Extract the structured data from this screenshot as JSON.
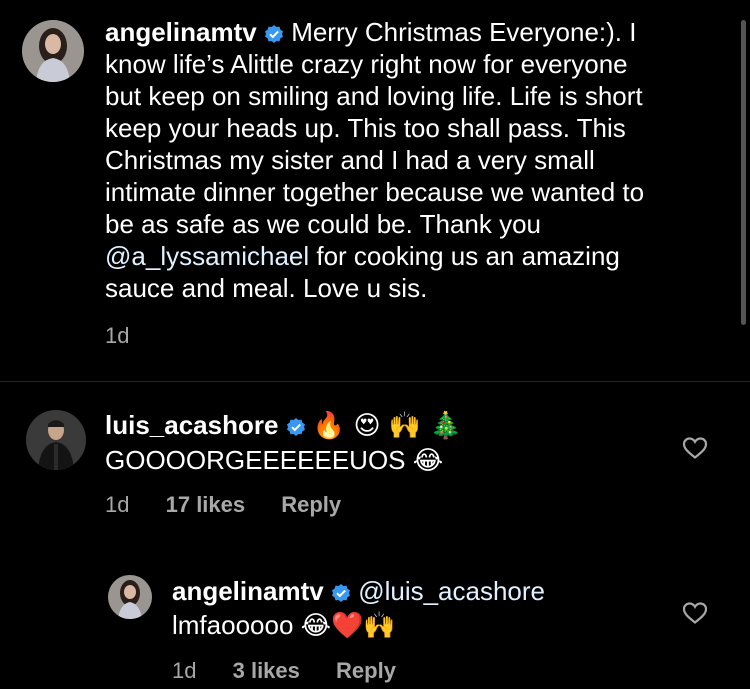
{
  "caption": {
    "username": "angelinamtv",
    "lines": [
      "Merry Christmas Everyone:). I",
      "know life’s Alittle crazy right now for everyone",
      "but keep on smiling and loving life. Life is short",
      "keep your heads up. This too shall pass. This",
      "Christmas my sister and I had a very small",
      "intimate dinner together because we wanted to",
      "be as safe as we could be. Thank you"
    ],
    "mention": "@a_lyssamichael",
    "line8_rest": " for cooking us an amazing",
    "line9": "sauce and meal. Love u sis.",
    "time": "1d"
  },
  "comment": {
    "username": "luis_acashore",
    "emojis_line1": "🔥 😍 🙌 🎄",
    "text": "GOOOORGEEEEEEUOS",
    "text_emoji": "😂",
    "time": "1d",
    "likes": "17 likes",
    "reply_label": "Reply"
  },
  "reply": {
    "username": "angelinamtv",
    "mention": "@luis_acashore",
    "text": "lmfaooooo",
    "text_emojis": "😂❤️🙌",
    "time": "1d",
    "likes": "3 likes",
    "reply_label": "Reply"
  },
  "colors": {
    "background": "#000000",
    "verified_badge": "#3897f0",
    "muted_text": "#a8a8a8"
  },
  "icons": [
    "verified-badge-icon",
    "heart-outline-icon"
  ]
}
